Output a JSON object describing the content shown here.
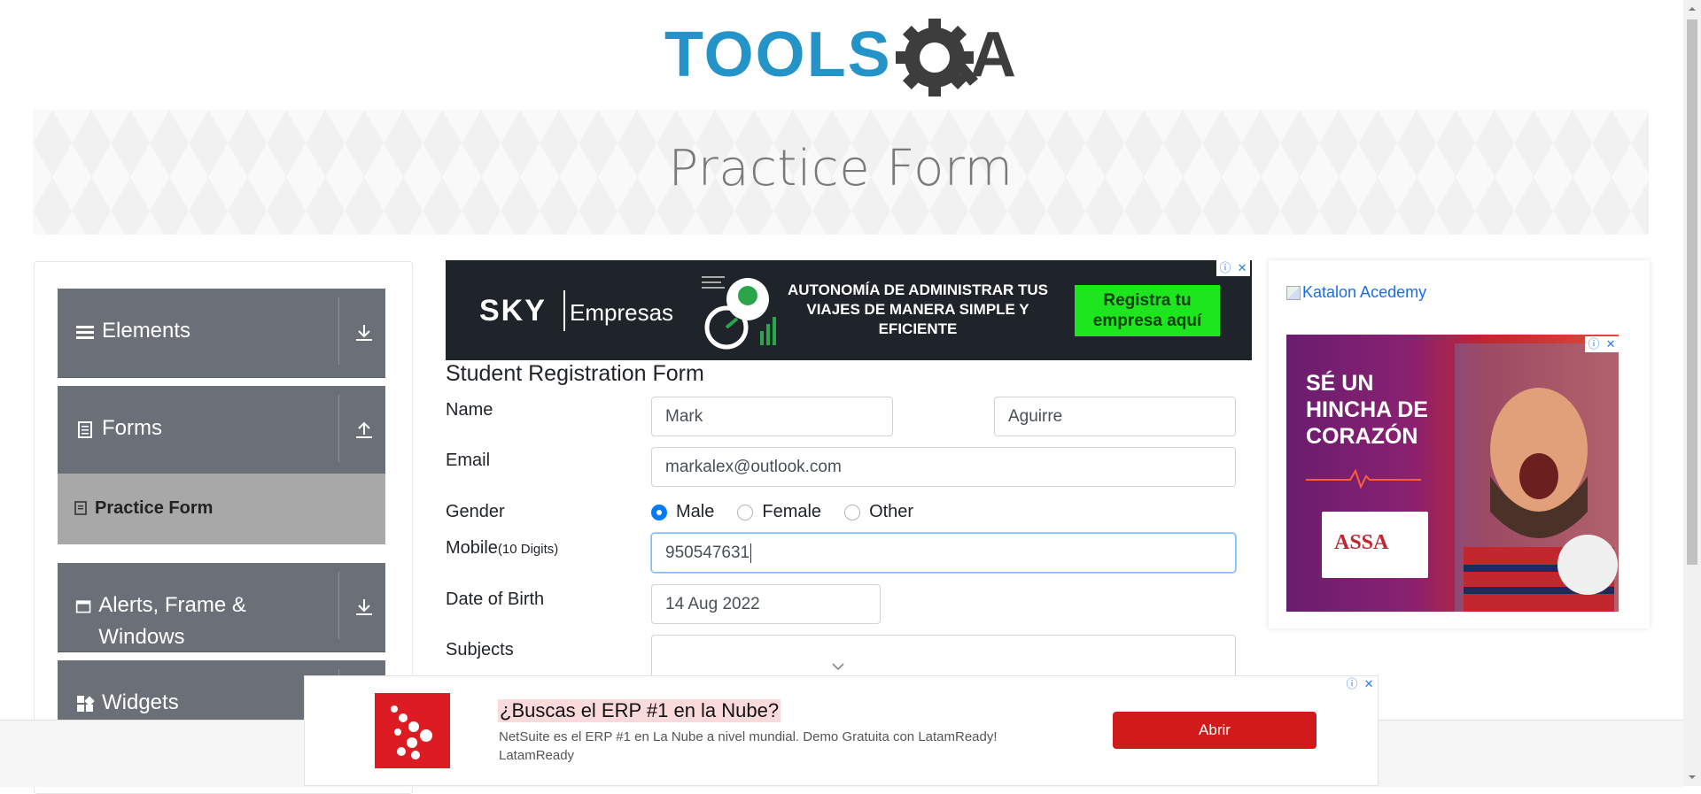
{
  "logo": {
    "text": "TOOLS",
    "suffix": "A",
    "alt": "ToolsQA"
  },
  "page_title": "Practice Form",
  "sidebar": {
    "groups": [
      {
        "label": "Elements",
        "icon": "hamburger-icon",
        "state": "collapsed"
      },
      {
        "label": "Forms",
        "icon": "document-icon",
        "state": "expanded"
      },
      {
        "label": "Alerts, Frame & Windows",
        "icon": "window-icon",
        "state": "collapsed"
      },
      {
        "label": "Widgets",
        "icon": "widgets-icon",
        "state": "collapsed"
      }
    ],
    "active_item": "Practice Form"
  },
  "top_ad": {
    "brand": "SKY",
    "brand_sub": "Empresas",
    "copy": "AUTONOMÍA DE ADMINISTRAR TUS VIAJES DE MANERA SIMPLE Y EFICIENTE",
    "cta": "Registra tu empresa aquí"
  },
  "form": {
    "title": "Student Registration Form",
    "name_label": "Name",
    "first_name": "Mark",
    "last_name": "Aguirre",
    "email_label": "Email",
    "email": "markalex@outlook.com",
    "gender_label": "Gender",
    "gender_options": [
      "Male",
      "Female",
      "Other"
    ],
    "gender_selected": "Male",
    "mobile_label": "Mobile",
    "mobile_hint": "(10 Digits)",
    "mobile": "950547631",
    "dob_label": "Date of Birth",
    "dob": "14 Aug 2022",
    "subjects_label": "Subjects",
    "subjects": ""
  },
  "right_ad": {
    "link_text": "Katalon Acedemy",
    "headline": "SÉ UN HINCHA DE CORAZÓN",
    "product": "ASSA"
  },
  "bottom_ad": {
    "headline": "¿Buscas el ERP #1 en la Nube?",
    "description": "NetSuite es el ERP #1 en La Nube a nivel mundial. Demo Gratuita con LatamReady! LatamReady",
    "button": "Abrir"
  },
  "colors": {
    "sidebar_bg": "#6b7078",
    "active_item_bg": "#a8a8a8",
    "radio_selected": "#007bff",
    "ad_cta_green": "#1ee61e",
    "ad_button_red": "#d11a1a"
  }
}
